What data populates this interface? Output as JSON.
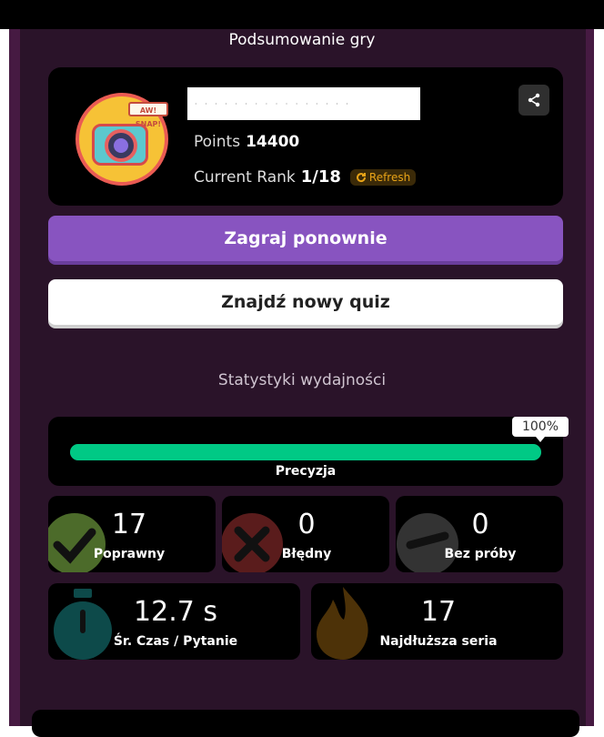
{
  "header": {
    "title": "Podsumowanie gry"
  },
  "player": {
    "avatar_text": "AW! SNAP!",
    "points_label": "Points",
    "points_value": "14400",
    "rank_label": "Current Rank",
    "rank_value": "1/18",
    "refresh_label": "Refresh",
    "share_icon": "share-icon"
  },
  "actions": {
    "play_again": "Zagraj ponownie",
    "find_quiz": "Znajdź nowy quiz"
  },
  "stats": {
    "title": "Statystyki wydajności",
    "accuracy": {
      "label": "Precyzja",
      "percent_text": "100%",
      "percent": 100
    },
    "correct": {
      "value": "17",
      "label": "Poprawny"
    },
    "incorrect": {
      "value": "0",
      "label": "Błędny"
    },
    "unattempted": {
      "value": "0",
      "label": "Bez próby"
    },
    "avg_time": {
      "value": "12.7 s",
      "label": "Śr. Czas / Pytanie"
    },
    "streak": {
      "value": "17",
      "label": "Najdłuższa seria"
    }
  },
  "colors": {
    "primary": "#8854c0",
    "accuracy_green": "#00c985",
    "refresh": "#e8a317"
  }
}
